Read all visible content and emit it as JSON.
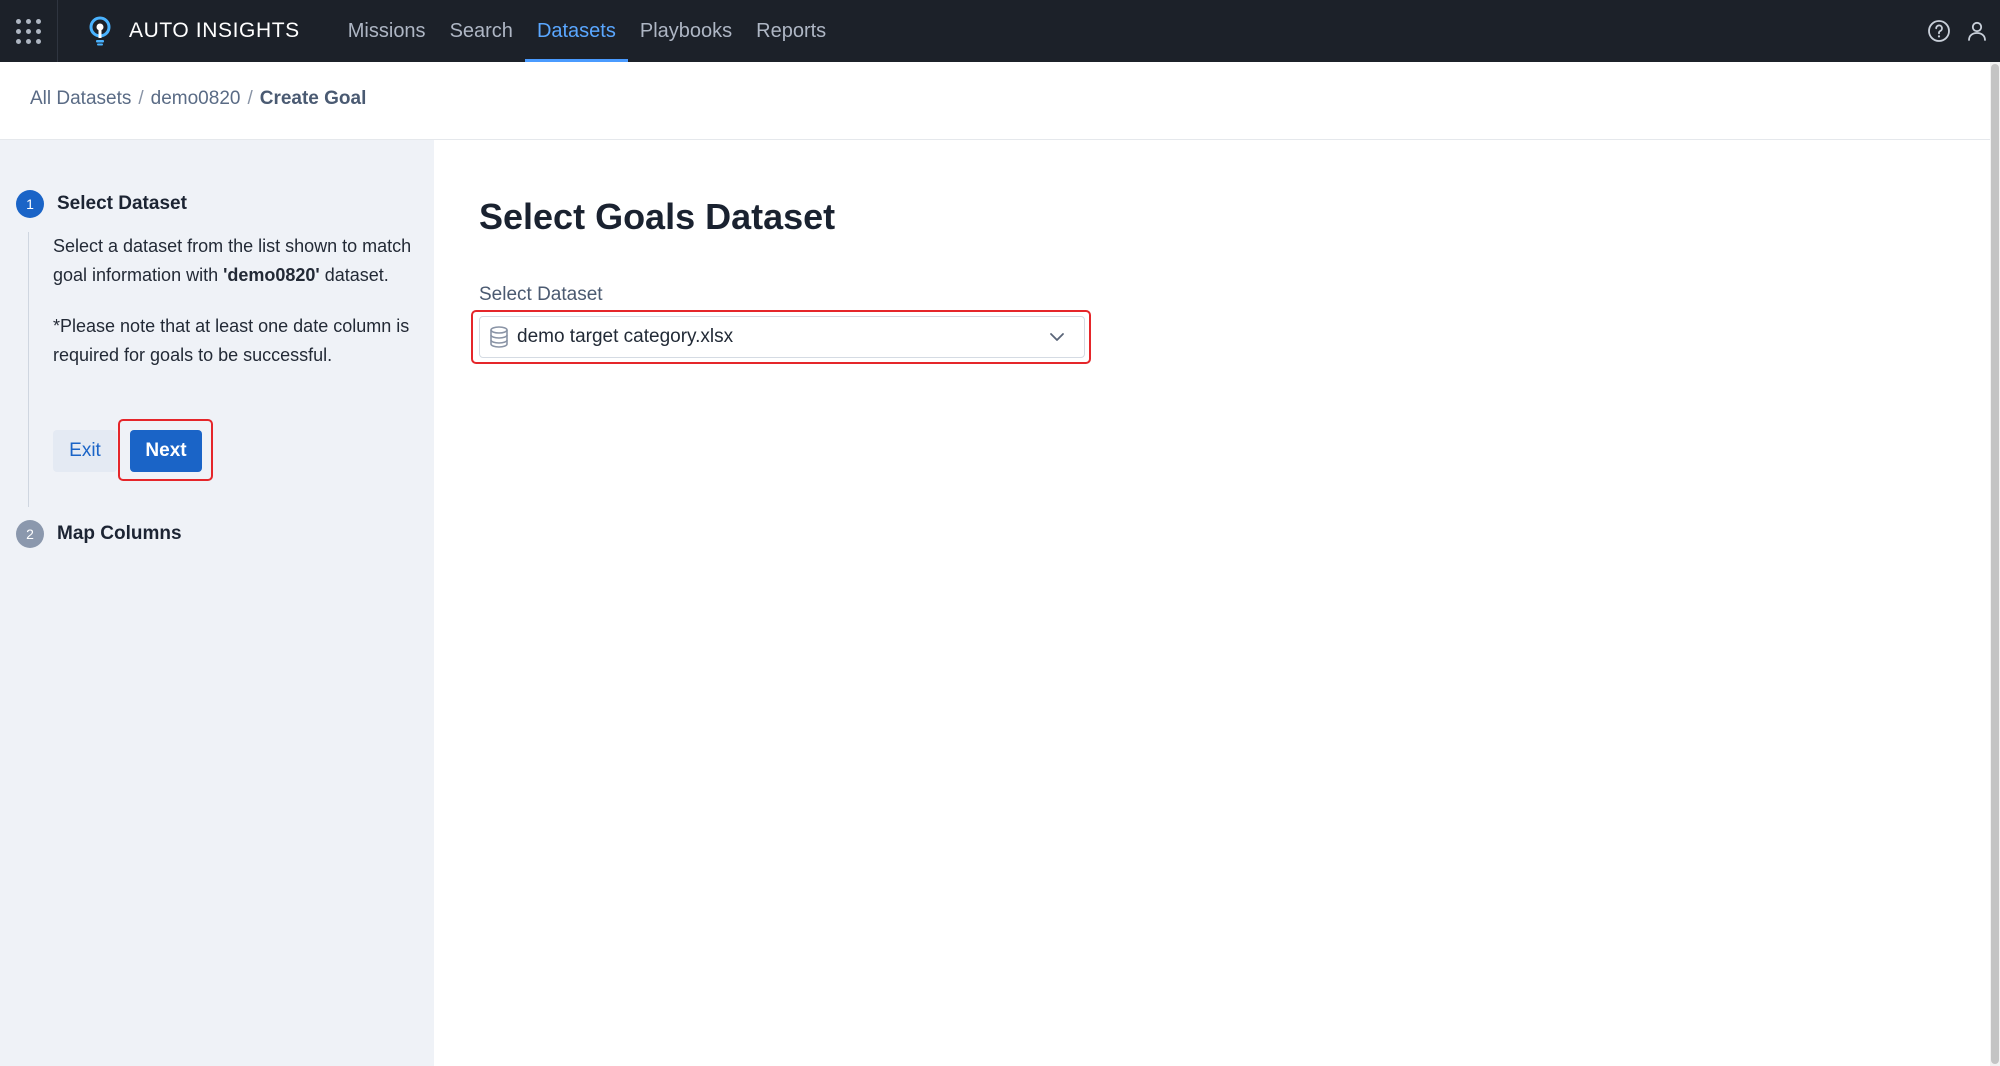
{
  "header": {
    "brand": "AUTO INSIGHTS",
    "nav": [
      {
        "label": "Missions",
        "active": false
      },
      {
        "label": "Search",
        "active": false
      },
      {
        "label": "Datasets",
        "active": true
      },
      {
        "label": "Playbooks",
        "active": false
      },
      {
        "label": "Reports",
        "active": false
      }
    ],
    "icons": [
      "apps-grid-icon",
      "lightbulb-logo-icon",
      "help-icon",
      "user-icon"
    ]
  },
  "breadcrumb": {
    "items": [
      "All Datasets",
      "demo0820"
    ],
    "separator": "/",
    "current": "Create Goal"
  },
  "sidebar": {
    "steps": [
      {
        "number": "1",
        "title": "Select Dataset",
        "state": "active"
      },
      {
        "number": "2",
        "title": "Map Columns",
        "state": "inactive"
      }
    ],
    "description": {
      "part1": "Select a dataset from the list shown to match goal information with ",
      "dataset_name": "'demo0820'",
      "part2": " dataset.",
      "note": "*Please note that at least one date column is required for goals to be successful."
    },
    "buttons": {
      "exit": "Exit",
      "next": "Next"
    }
  },
  "main": {
    "title": "Select Goals Dataset",
    "field_label": "Select Dataset",
    "select_value": "demo target category.xlsx",
    "select_icon": "database-icon"
  },
  "colors": {
    "topbar_bg": "#1c2129",
    "active_nav": "#5aa7ff",
    "primary": "#1a64c7",
    "highlight": "#e5262a",
    "sidebar_bg": "#eff2f7"
  }
}
